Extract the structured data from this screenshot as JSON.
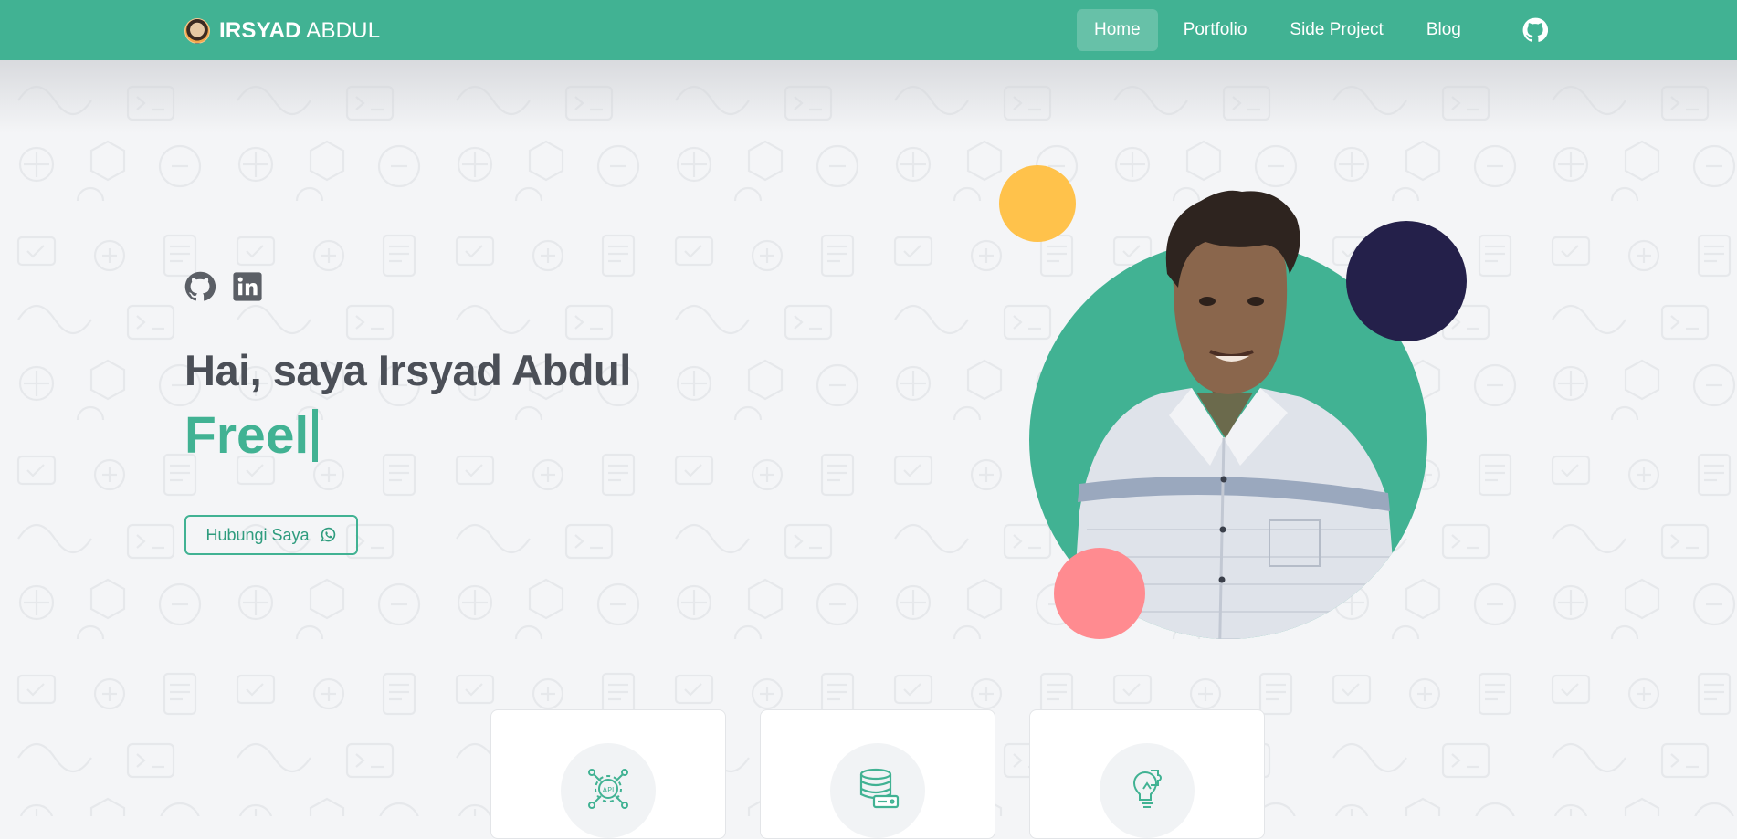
{
  "navbar": {
    "brand_first": "IRSYAD",
    "brand_last": "ABDUL",
    "links": [
      {
        "label": "Home",
        "active": true
      },
      {
        "label": "Portfolio",
        "active": false
      },
      {
        "label": "Side Project",
        "active": false
      },
      {
        "label": "Blog",
        "active": false
      }
    ],
    "github_icon": "github-icon"
  },
  "hero": {
    "social_icons": [
      "github-icon",
      "linkedin-icon"
    ],
    "title": "Hai, saya Irsyad Abdul",
    "typed_text": "Freel",
    "cta_label": "Hubungi Saya",
    "cta_icon": "whatsapp-icon"
  },
  "cards": [
    {
      "icon": "api-gear-icon"
    },
    {
      "icon": "database-server-icon"
    },
    {
      "icon": "lightbulb-puzzle-icon"
    }
  ],
  "colors": {
    "primary": "#41b293",
    "text_dark": "#4b4f57",
    "circle_yellow": "#ffc24b",
    "circle_navy": "#24204a",
    "circle_pink": "#ff8b90"
  }
}
